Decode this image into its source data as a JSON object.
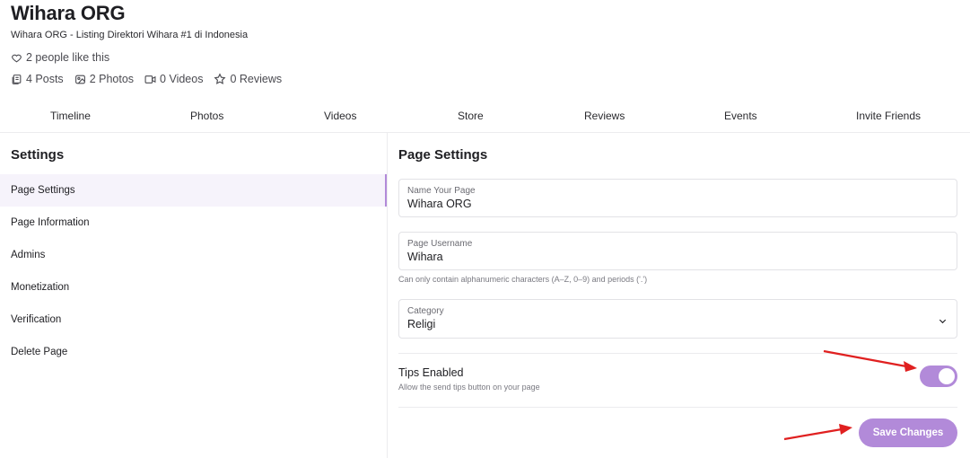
{
  "header": {
    "title": "Wihara ORG",
    "subtitle": "Wihara ORG - Listing Direktori Wihara #1 di Indonesia",
    "likes": "2 people like this",
    "stats": [
      {
        "icon": "posts-icon",
        "label": "4 Posts"
      },
      {
        "icon": "photos-icon",
        "label": "2 Photos"
      },
      {
        "icon": "videos-icon",
        "label": "0 Videos"
      },
      {
        "icon": "star-icon",
        "label": "0 Reviews"
      }
    ]
  },
  "tabs": [
    "Timeline",
    "Photos",
    "Videos",
    "Store",
    "Reviews",
    "Events",
    "Invite Friends"
  ],
  "settings": {
    "title": "Settings",
    "menu": [
      "Page Settings",
      "Page Information",
      "Admins",
      "Monetization",
      "Verification",
      "Delete Page"
    ],
    "active_index": 0
  },
  "page_settings": {
    "title": "Page Settings",
    "name_label": "Name Your Page",
    "name_value": "Wihara ORG",
    "username_label": "Page Username",
    "username_value": "Wihara",
    "username_helper": "Can only contain alphanumeric characters (A–Z, 0–9) and periods ('.')",
    "category_label": "Category",
    "category_value": "Religi",
    "tips_title": "Tips Enabled",
    "tips_desc": "Allow the send tips button on your page",
    "tips_enabled": true,
    "save_label": "Save Changes"
  },
  "colors": {
    "accent": "#b28ad9",
    "annotation_arrow": "#e02020"
  }
}
